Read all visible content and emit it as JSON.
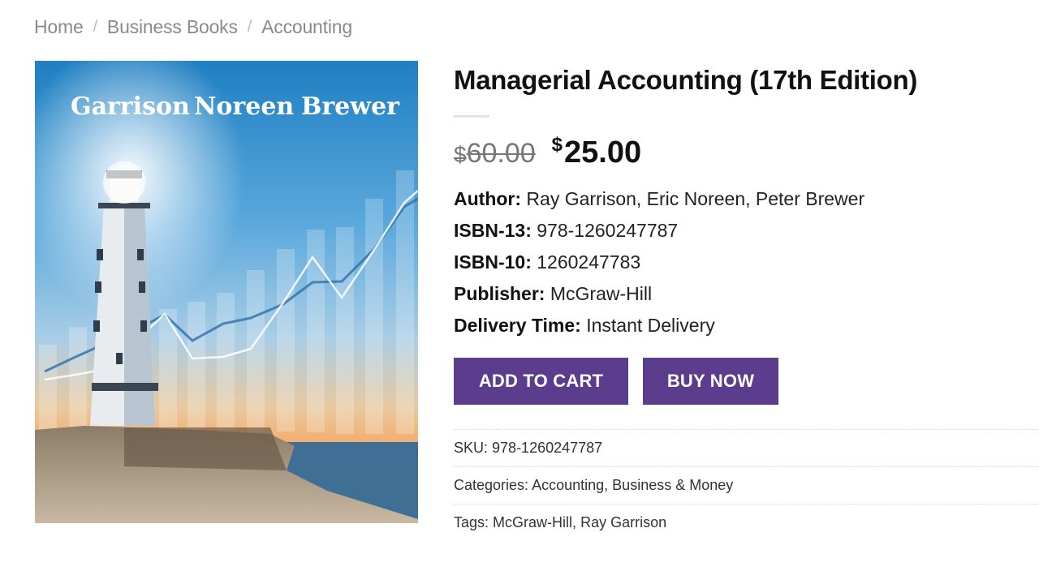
{
  "breadcrumb": {
    "items": [
      "Home",
      "Business Books",
      "Accounting"
    ],
    "separator": "/"
  },
  "product": {
    "cover_authors": [
      "Garrison",
      "Noreen",
      "Brewer"
    ],
    "title": "Managerial Accounting (17th Edition)",
    "old_price_currency": "$",
    "old_price": "60.00",
    "price_currency": "$",
    "price": "25.00",
    "specs": [
      {
        "label": "Author:",
        "value": "Ray Garrison, Eric Noreen, Peter Brewer"
      },
      {
        "label": "ISBN-13:",
        "value": "978-1260247787"
      },
      {
        "label": "ISBN-10:",
        "value": "1260247783"
      },
      {
        "label": "Publisher:",
        "value": "McGraw-Hill"
      },
      {
        "label": "Delivery Time:",
        "value": "Instant Delivery"
      }
    ]
  },
  "buttons": {
    "add_to_cart": "ADD TO CART",
    "buy_now": "BUY NOW",
    "color": "#5c3c8c"
  },
  "meta": {
    "sku_label": "SKU:",
    "sku_value": "978-1260247787",
    "categories_label": "Categories:",
    "categories": [
      "Accounting",
      "Business & Money"
    ],
    "tags_label": "Tags:",
    "tags": [
      "McGraw-Hill",
      "Ray Garrison"
    ]
  }
}
